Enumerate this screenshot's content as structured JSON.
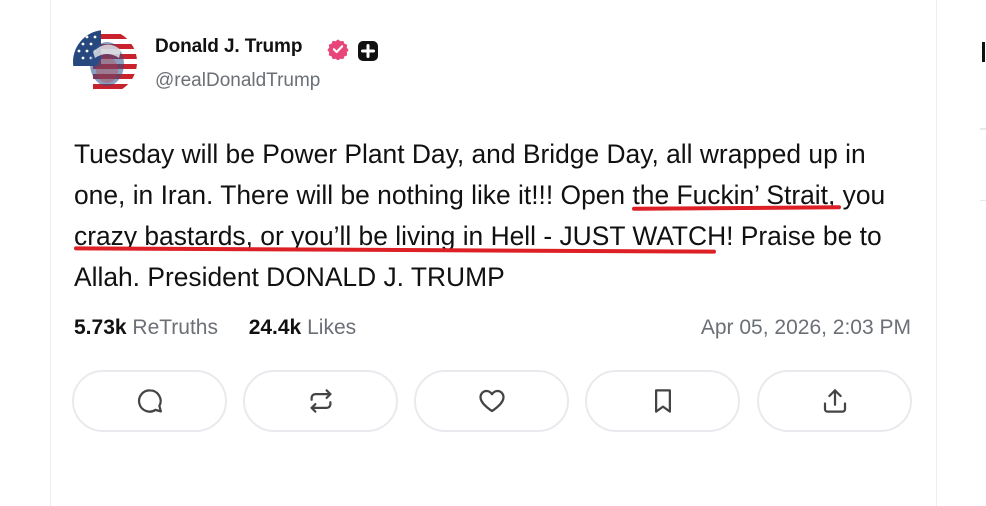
{
  "post": {
    "author": {
      "name": "Donald J. Trump",
      "handle": "@realDonaldTrump",
      "verified_color": "#e8457a"
    },
    "text_segments": [
      "Tuesday will be Power Plant Day, and Bridge Day, all wrapped up in one, in Iran. There will be nothing like it!!! ",
      "Open the Fuckin’ Strait, you crazy bastards, or you’ll be living in Hell",
      " - JUST WATCH! Praise be to Allah. President DONALD J. TRUMP"
    ],
    "highlight_color": "#dd1f26",
    "stats": {
      "retruths_count": "5.73k",
      "retruths_label": "ReTruths",
      "likes_count": "24.4k",
      "likes_label": "Likes"
    },
    "timestamp": "Apr 05, 2026, 2:03 PM"
  },
  "actions": [
    {
      "name": "reply",
      "icon": "comment-icon"
    },
    {
      "name": "retruth",
      "icon": "repost-icon"
    },
    {
      "name": "like",
      "icon": "heart-icon"
    },
    {
      "name": "bookmark",
      "icon": "bookmark-icon"
    },
    {
      "name": "share",
      "icon": "share-icon"
    }
  ]
}
